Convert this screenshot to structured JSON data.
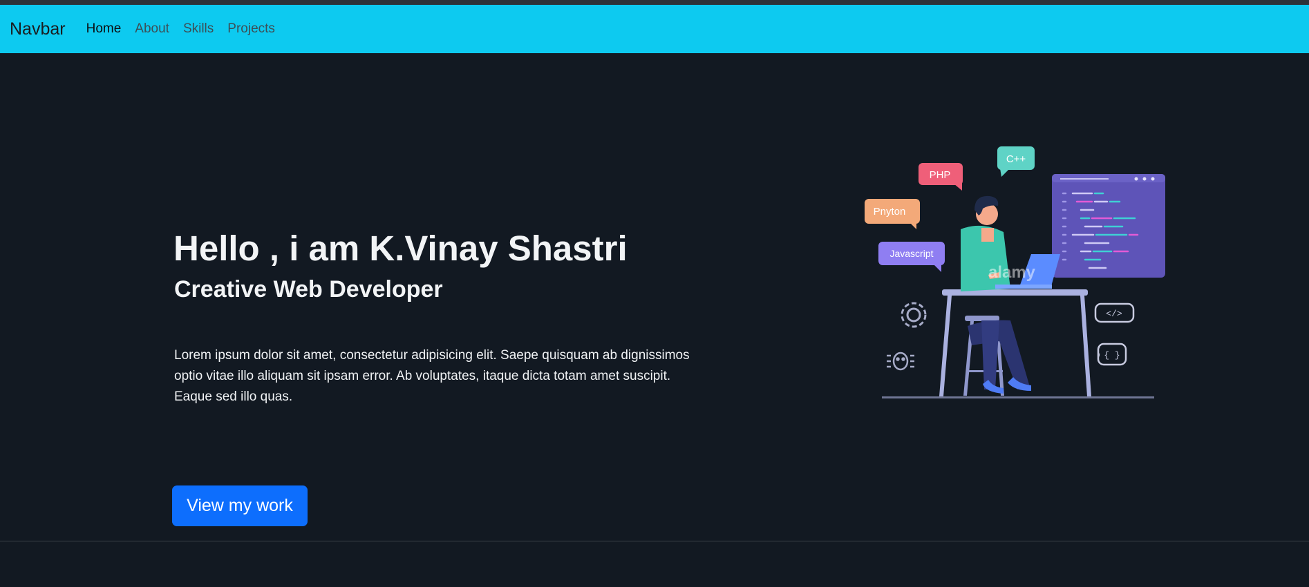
{
  "navbar": {
    "brand": "Navbar",
    "links": [
      {
        "label": "Home",
        "active": true
      },
      {
        "label": "About",
        "active": false
      },
      {
        "label": "Skills",
        "active": false
      },
      {
        "label": "Projects",
        "active": false
      }
    ],
    "background": "#0dcaf0"
  },
  "hero": {
    "title": "Hello , i am K.Vinay Shastri",
    "subtitle": "Creative Web Developer",
    "description": "Lorem ipsum dolor sit amet, consectetur adipisicing elit. Saepe quisquam ab dignissimos optio vitae illo aliquam sit ipsam error. Ab voluptates, itaque dicta totam amet suscipit. Eaque sed illo quas.",
    "cta_label": "View my work"
  },
  "illustration": {
    "bubbles": {
      "php": "PHP",
      "cpp": "C++",
      "python": "Pnyton",
      "javascript": "Javascript"
    },
    "watermark": "alamy",
    "code_tag": "</>",
    "braces": "{ }",
    "semicolon": ";"
  },
  "colors": {
    "page_background": "#121922",
    "primary_button": "#0d6efd"
  }
}
